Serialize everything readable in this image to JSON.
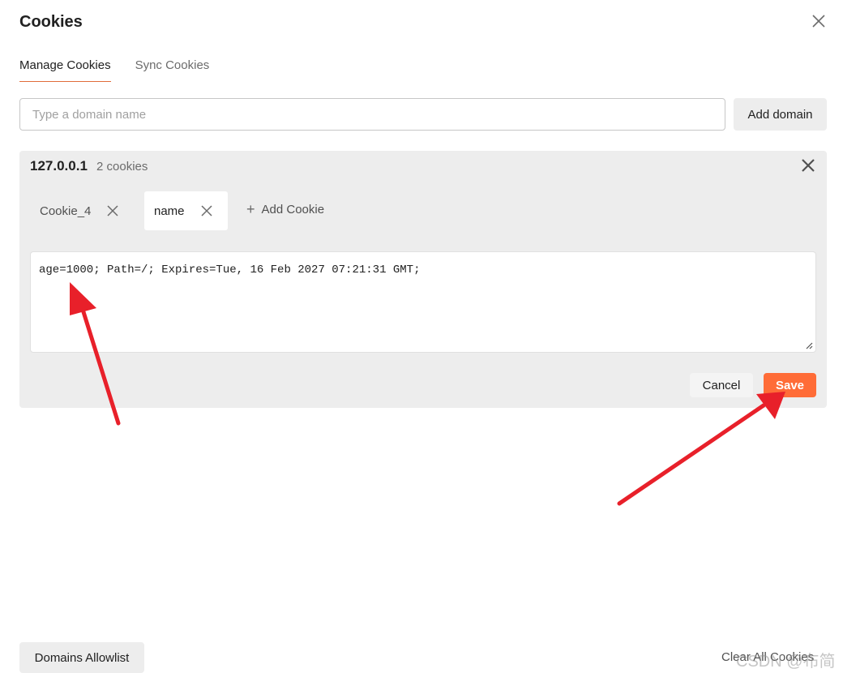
{
  "dialog": {
    "title": "Cookies",
    "close_icon": "close-icon"
  },
  "tabs": [
    {
      "label": "Manage Cookies",
      "active": true
    },
    {
      "label": "Sync Cookies",
      "active": false
    }
  ],
  "domain_input": {
    "placeholder": "Type a domain name",
    "value": ""
  },
  "add_domain_label": "Add domain",
  "domain_panel": {
    "domain": "127.0.0.1",
    "cookie_count": "2 cookies",
    "cookies": [
      {
        "label": "Cookie_4",
        "selected": false
      },
      {
        "label": "name",
        "selected": true
      }
    ],
    "add_cookie_label": "Add Cookie",
    "cookie_value": "age=1000; Path=/; Expires=Tue, 16 Feb 2027 07:21:31 GMT;",
    "cancel_label": "Cancel",
    "save_label": "Save"
  },
  "footer": {
    "allowlist_label": "Domains Allowlist",
    "clear_all_label": "Clear All Cookies",
    "watermark": "CSDN @布简特"
  },
  "colors": {
    "accent": "#ff6c37",
    "tab_underline": "#e06c3a",
    "annotation_arrow": "#e8202a"
  }
}
